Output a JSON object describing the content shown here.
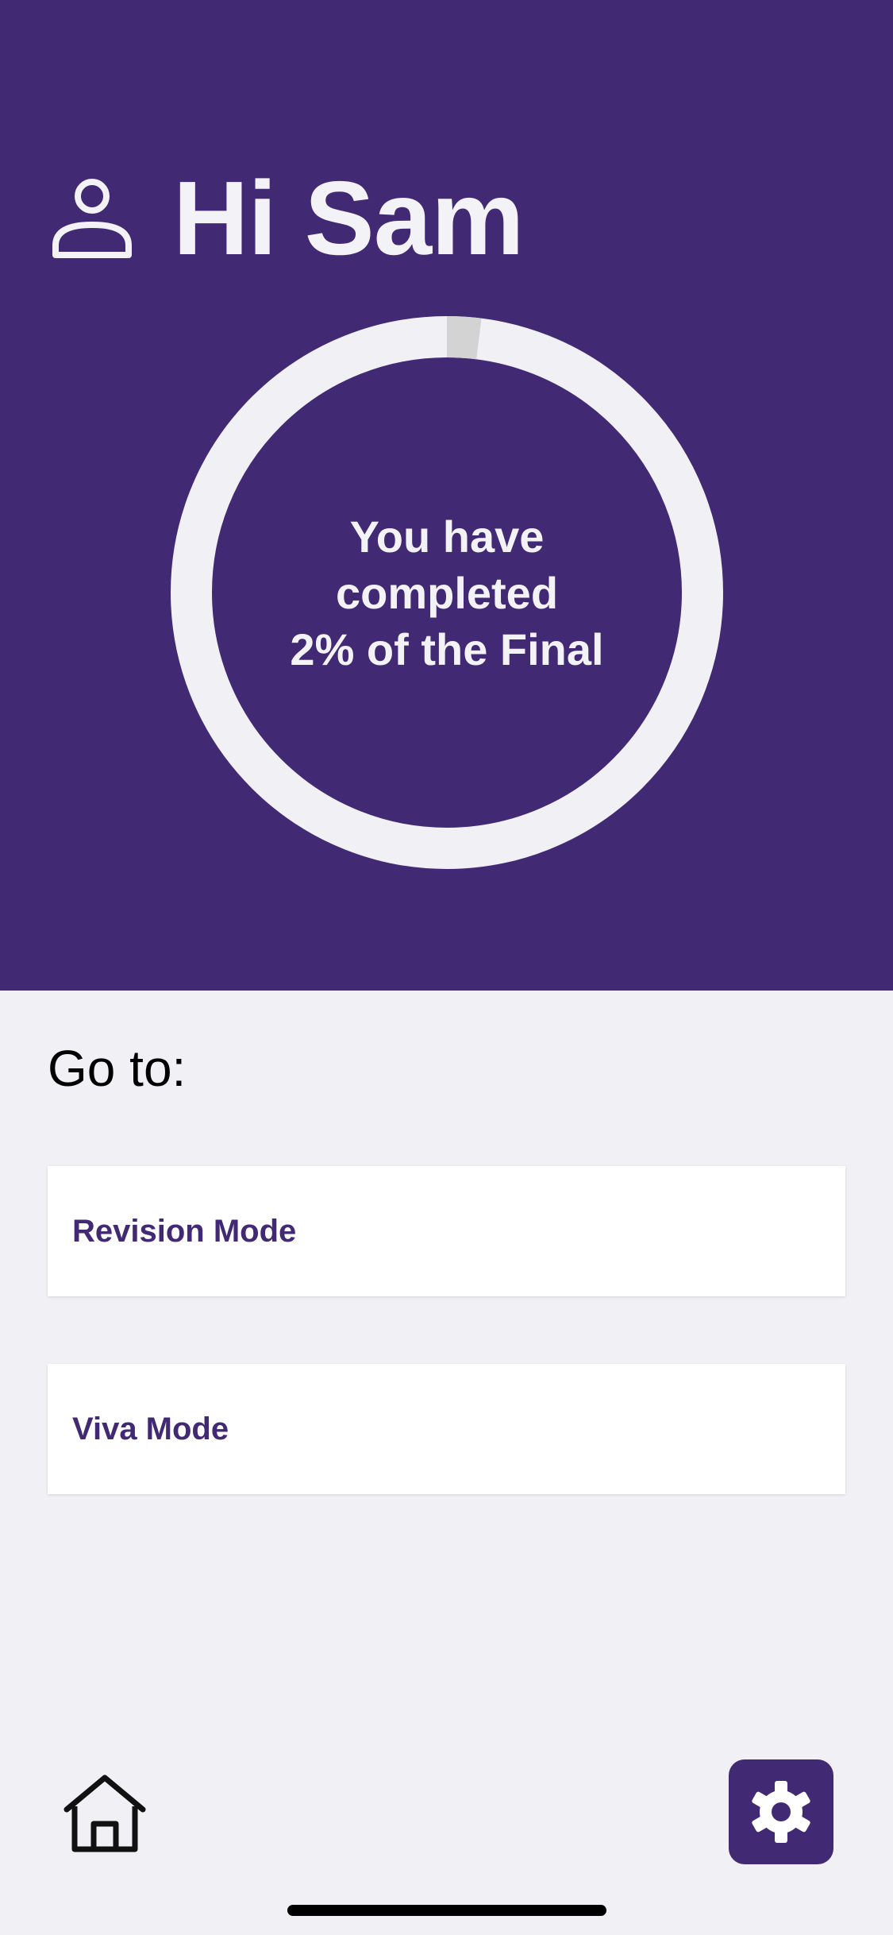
{
  "header": {
    "greeting": "Hi Sam",
    "user_icon": "user-icon"
  },
  "progress": {
    "percent": 2,
    "line1": "You have",
    "line2": "completed",
    "line3": "2% of the Final",
    "track_color": "#f0f0f5",
    "fill_color": "#d3d3d3"
  },
  "navigation": {
    "heading": "Go to:",
    "items": [
      {
        "label": "Revision Mode"
      },
      {
        "label": "Viva Mode"
      }
    ]
  },
  "bottom_bar": {
    "home_icon": "home-icon",
    "settings_icon": "gear-icon"
  },
  "colors": {
    "brand": "#412a73",
    "background": "#f0f0f5",
    "card": "#ffffff"
  }
}
